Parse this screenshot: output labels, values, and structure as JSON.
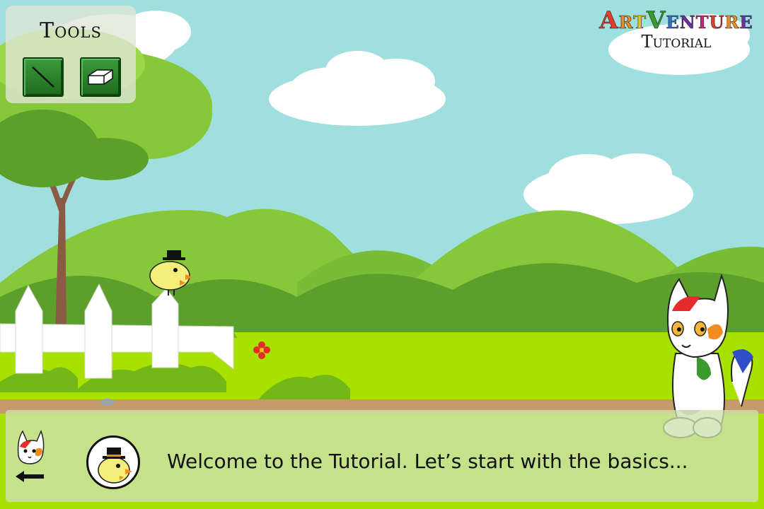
{
  "tools_panel": {
    "title": "Tools",
    "tools": [
      {
        "name": "pencil"
      },
      {
        "name": "eraser"
      }
    ]
  },
  "logo": {
    "main_letters": [
      {
        "ch": "A",
        "color": "#e53c2a"
      },
      {
        "ch": "r",
        "color": "#f28c1e"
      },
      {
        "ch": "t",
        "color": "#f5c21b"
      },
      {
        "ch": "V",
        "color": "#3a9a2e"
      },
      {
        "ch": "e",
        "color": "#2e6fd0"
      },
      {
        "ch": "n",
        "color": "#6b2fa8"
      },
      {
        "ch": "t",
        "color": "#c62a7a"
      },
      {
        "ch": "u",
        "color": "#e53c2a"
      },
      {
        "ch": "r",
        "color": "#f28c1e"
      },
      {
        "ch": "e",
        "color": "#6b2fa8"
      }
    ],
    "subtitle": "Tutorial"
  },
  "dialog": {
    "text": "Welcome to the Tutorial. Let’s start with the basics..."
  },
  "colors": {
    "sky": "#9fe0de",
    "grass": "#a8e000",
    "hill_light": "#86c83a",
    "hill_dark": "#5aa02a",
    "path": "#c69a6a",
    "tool_button": "#2a7a2a"
  }
}
